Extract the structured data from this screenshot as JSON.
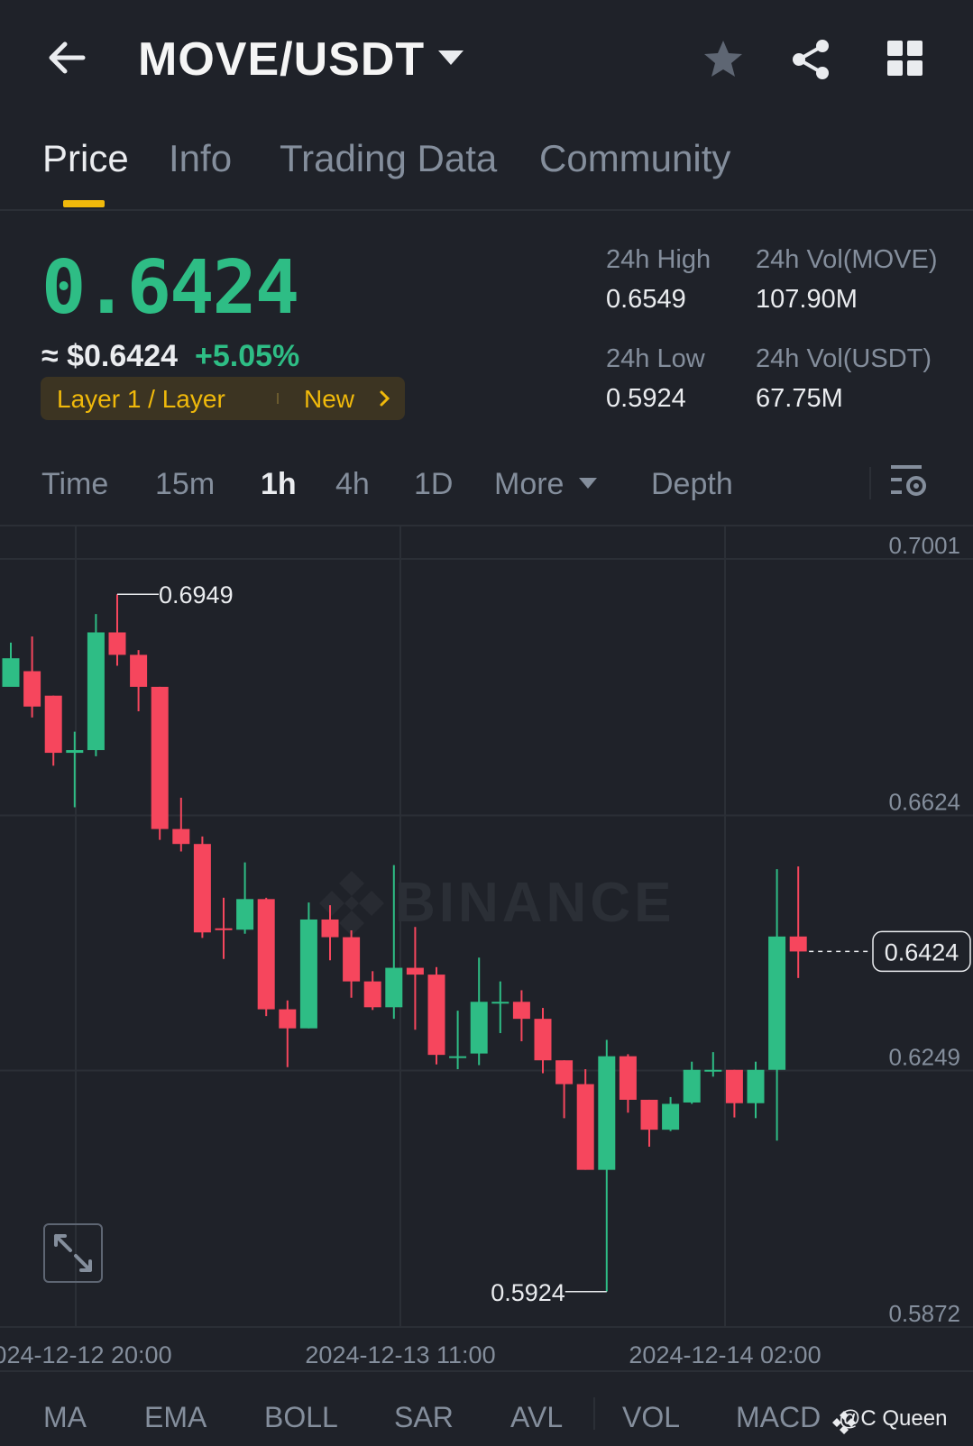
{
  "header": {
    "pair": "MOVE/USDT",
    "icons": [
      "back-arrow-icon",
      "caret-down-icon",
      "star-icon",
      "share-icon",
      "grid-menu-icon"
    ]
  },
  "tabs": [
    {
      "label": "Price",
      "active": true
    },
    {
      "label": "Info",
      "active": false
    },
    {
      "label": "Trading Data",
      "active": false
    },
    {
      "label": "Community",
      "active": false
    }
  ],
  "price": {
    "last": "0.6424",
    "usd": "≈ $0.6424",
    "change": "+5.05%",
    "tag_label": "Layer 1 / Layer",
    "tag_new": "New"
  },
  "stats": {
    "high_label": "24h High",
    "high_value": "0.6549",
    "vol_move_label": "24h Vol(MOVE)",
    "vol_move_value": "107.90M",
    "low_label": "24h Low",
    "low_value": "0.5924",
    "vol_usdt_label": "24h Vol(USDT)",
    "vol_usdt_value": "67.75M"
  },
  "timeframes": {
    "time": "Time",
    "m15": "15m",
    "h1": "1h",
    "h4": "4h",
    "d1": "1D",
    "more": "More",
    "depth": "Depth"
  },
  "chart_data": {
    "type": "candlestick",
    "interval": "1h",
    "watermark": "BINANCE",
    "y_ticks": [
      "0.7001",
      "0.6624",
      "0.6249",
      "0.5872"
    ],
    "ylim": [
      0.5872,
      0.7001
    ],
    "x_ticks": [
      "2024-12-12 20:00",
      "2024-12-13 11:00",
      "2024-12-14 02:00"
    ],
    "high_marker": "0.6949",
    "low_marker": "0.5924",
    "last_price_label": "0.6424",
    "colors": {
      "up": "#2ebd85",
      "down": "#f6465d",
      "grid": "#2b2f36",
      "axis_text": "#848e9c"
    },
    "candles": [
      [
        0.6813,
        0.6855,
        0.6838,
        0.6878
      ],
      [
        0.6836,
        0.6784,
        0.6768,
        0.6887
      ],
      [
        0.68,
        0.6716,
        0.6697,
        0.68
      ],
      [
        0.6716,
        0.672,
        0.6636,
        0.6747
      ],
      [
        0.672,
        0.6893,
        0.6711,
        0.692
      ],
      [
        0.6893,
        0.686,
        0.6844,
        0.6949
      ],
      [
        0.686,
        0.6813,
        0.6777,
        0.6867
      ],
      [
        0.6813,
        0.6604,
        0.6588,
        0.6813
      ],
      [
        0.6604,
        0.6582,
        0.6571,
        0.665
      ],
      [
        0.6582,
        0.6452,
        0.6444,
        0.6593
      ],
      [
        0.6458,
        0.6456,
        0.6413,
        0.6503
      ],
      [
        0.6456,
        0.6501,
        0.645,
        0.6555
      ],
      [
        0.6501,
        0.6339,
        0.6329,
        0.6503
      ],
      [
        0.6339,
        0.6311,
        0.6254,
        0.6352
      ],
      [
        0.6311,
        0.6471,
        0.6311,
        0.6496
      ],
      [
        0.6471,
        0.6445,
        0.6411,
        0.6492
      ],
      [
        0.6445,
        0.638,
        0.6356,
        0.6455
      ],
      [
        0.638,
        0.6342,
        0.6338,
        0.6395
      ],
      [
        0.6342,
        0.64,
        0.6325,
        0.6551
      ],
      [
        0.64,
        0.639,
        0.6309,
        0.646
      ],
      [
        0.639,
        0.6272,
        0.6258,
        0.6401
      ],
      [
        0.627,
        0.627,
        0.6251,
        0.6337
      ],
      [
        0.6274,
        0.635,
        0.6257,
        0.6415
      ],
      [
        0.635,
        0.635,
        0.6304,
        0.638
      ],
      [
        0.635,
        0.6325,
        0.6292,
        0.6367
      ],
      [
        0.6325,
        0.6264,
        0.6245,
        0.6341
      ],
      [
        0.6264,
        0.6229,
        0.6179,
        0.6264
      ],
      [
        0.6229,
        0.6103,
        0.6103,
        0.6251
      ],
      [
        0.6103,
        0.627,
        0.5924,
        0.6294
      ],
      [
        0.627,
        0.6206,
        0.6187,
        0.6273
      ],
      [
        0.6206,
        0.6162,
        0.6137,
        0.6206
      ],
      [
        0.6162,
        0.62,
        0.616,
        0.621
      ],
      [
        0.6202,
        0.625,
        0.62,
        0.6262
      ],
      [
        0.625,
        0.625,
        0.624,
        0.6276
      ],
      [
        0.625,
        0.6201,
        0.618,
        0.625
      ],
      [
        0.6201,
        0.625,
        0.6179,
        0.6262
      ],
      [
        0.625,
        0.6446,
        0.6146,
        0.6545
      ],
      [
        0.6446,
        0.6424,
        0.6385,
        0.6549
      ]
    ]
  },
  "indicators": [
    "MA",
    "EMA",
    "BOLL",
    "SAR",
    "AVL",
    "VOL",
    "MACD"
  ],
  "watermark_user": "@C Queen"
}
